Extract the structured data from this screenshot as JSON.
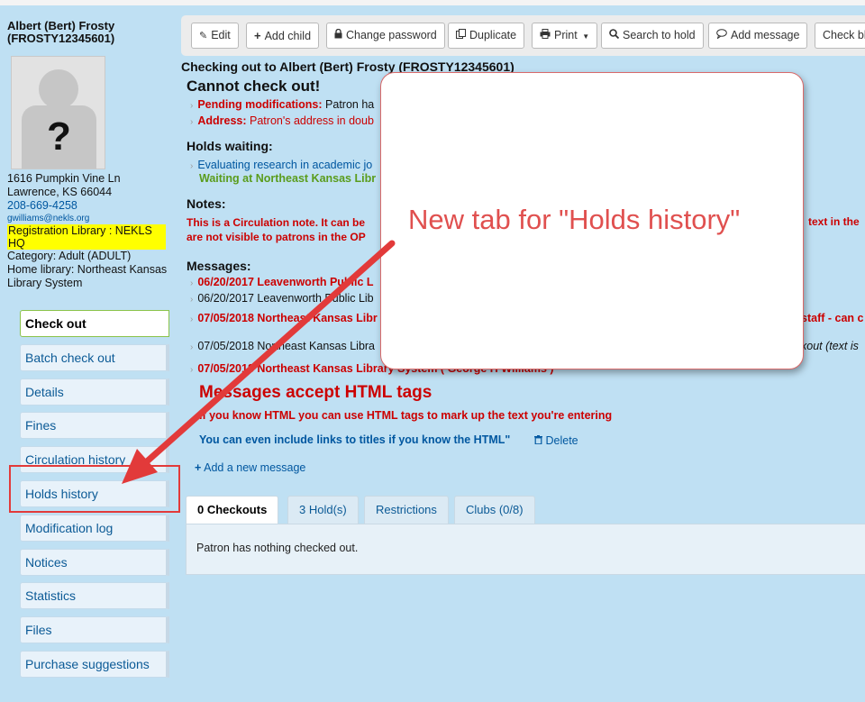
{
  "patron": {
    "name_line1": "Albert (Bert) Frosty",
    "name_line2": "(FROSTY12345601)",
    "photo_placeholder": "?",
    "address_line1": "1616 Pumpkin Vine Ln",
    "address_line2": "Lawrence, KS 66044",
    "phone": "208-669-4258",
    "email": "gwilliams@nekls.org",
    "registration_library": "Registration Library : NEKLS HQ",
    "category": "Category: Adult (ADULT)",
    "home_library": "Home library: Northeast Kansas Library System"
  },
  "sidebar": {
    "items": [
      {
        "label": "Check out"
      },
      {
        "label": "Batch check out"
      },
      {
        "label": "Details"
      },
      {
        "label": "Fines"
      },
      {
        "label": "Circulation history"
      },
      {
        "label": "Holds history"
      },
      {
        "label": "Modification log"
      },
      {
        "label": "Notices"
      },
      {
        "label": "Statistics"
      },
      {
        "label": "Files"
      },
      {
        "label": "Purchase suggestions"
      }
    ]
  },
  "toolbar": {
    "edit": "Edit",
    "add_child": "Add child",
    "change_password": "Change password",
    "duplicate": "Duplicate",
    "print": "Print",
    "search_to_hold": "Search to hold",
    "add_message": "Add message",
    "check_bl": "Check bl"
  },
  "main": {
    "checking_out": "Checking out to Albert (Bert) Frosty (FROSTY12345601)",
    "cannot_check_out": "Cannot check out!",
    "pending_label": "Pending modifications:",
    "pending_text": "Patron ha",
    "address_label": "Address:",
    "address_text": "Patron's address in doub",
    "holds_waiting": "Holds waiting:",
    "hold_title": "Evaluating research in academic jo",
    "hold_waiting_at": "Waiting at Northeast Kansas Libr",
    "notes": "Notes:",
    "note_text": "This is a Circulation note. It can be",
    "note_text2": "are not visible to patrons in the OP",
    "note_right": "text in the",
    "messages": "Messages:",
    "msg1": "06/20/2017 Leavenworth Public L",
    "msg2": "06/20/2017 Leavenworth Public Lib",
    "msg3": "07/05/2018 Northeast Kansas Libr",
    "msg3_right": "staff - can c",
    "msg4": "07/05/2018 Northeast Kansas Libra",
    "msg4_right": "kout (text is",
    "msg5": "07/05/2018 Northeast Kansas Library System ( George H Williams )",
    "html_heading": "Messages accept HTML tags",
    "html_sub": "If you know HTML you can use HTML tags to mark up the text you're entering",
    "html_link": "You can even include links to titles if you know the HTML\"",
    "delete": "Delete",
    "add_new_message": "Add a new message"
  },
  "tabs": [
    {
      "label": "0 Checkouts"
    },
    {
      "label": "3 Hold(s)"
    },
    {
      "label": "Restrictions"
    },
    {
      "label": "Clubs (0/8)"
    }
  ],
  "tab_panel_text": "Patron has nothing checked out.",
  "callout": {
    "text": "New tab for \"Holds history\""
  },
  "colors": {
    "background": "#bfe0f3",
    "accent_red": "#cc0000",
    "link_blue": "#0057a0",
    "annotation_red": "#e23a3a",
    "highlight_yellow": "#ffff00"
  }
}
